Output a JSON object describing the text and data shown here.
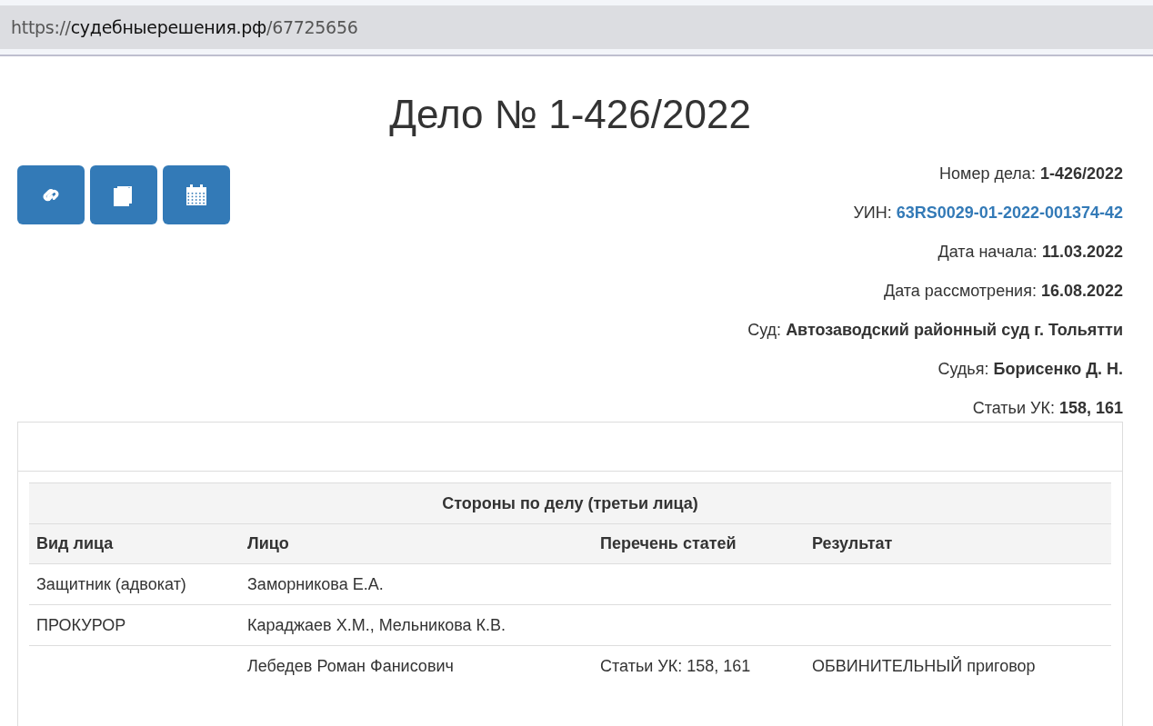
{
  "address_bar": {
    "scheme": "https://",
    "host": "судебныерешения.рф",
    "path": "/67725656"
  },
  "title": "Дело № 1-426/2022",
  "details": [
    {
      "label": "Номер дела:",
      "value": "1-426/2022",
      "kind": "text"
    },
    {
      "label": "УИН:",
      "value": "63RS0029-01-2022-001374-42",
      "kind": "link"
    },
    {
      "label": "Дата начала:",
      "value": "11.03.2022",
      "kind": "text"
    },
    {
      "label": "Дата рассмотрения:",
      "value": "16.08.2022",
      "kind": "text"
    },
    {
      "label": "Суд:",
      "value": "Автозаводский районный суд г. Тольятти",
      "kind": "text"
    },
    {
      "label": "Судья:",
      "value": "Борисенко Д. Н.",
      "kind": "text"
    },
    {
      "label": "Статьи УК:",
      "value": "158, 161",
      "kind": "text"
    }
  ],
  "table": {
    "caption": "Стороны по делу (третьи лица)",
    "columns": [
      "Вид лица",
      "Лицо",
      "Перечень статей",
      "Результат"
    ],
    "rows": [
      [
        "Защитник (адвокат)",
        "Заморникова Е.А.",
        "",
        ""
      ],
      [
        "ПРОКУРОР",
        "Караджаев Х.М., Мельникова К.В.",
        "",
        ""
      ],
      [
        "",
        "Лебедев Роман Фанисович",
        "Статьи УК: 158, 161",
        "ОБВИНИТЕЛЬНЫЙ приговор"
      ]
    ]
  }
}
